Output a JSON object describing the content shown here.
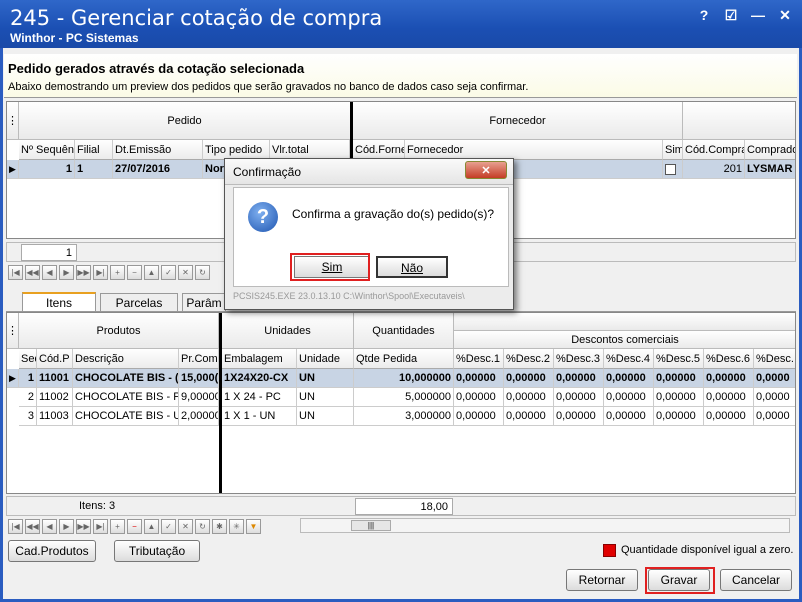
{
  "window": {
    "title": "245 - Gerenciar cotação de compra",
    "subtitle": "Winthor - PC Sistemas",
    "controls": [
      "?",
      "☑",
      "—",
      "✕"
    ]
  },
  "header": {
    "title": "Pedido gerados através da cotação selecionada",
    "description": "Abaixo demostrando um preview dos pedidos que serão gravados no banco de dados caso seja confirmar."
  },
  "orders": {
    "group_headers": {
      "pedido": "Pedido",
      "fornecedor": "Fornecedor"
    },
    "columns": [
      "Nº Sequên",
      "Filial",
      "Dt.Emissão",
      "Tipo pedido",
      "Vlr.total",
      "Cód.Forne",
      "Fornecedor",
      "Sim",
      "Cód.Compra",
      "Comprado"
    ],
    "row": {
      "seq": "1",
      "filial": "1",
      "dt": "27/07/2016",
      "tipo": "Nor",
      "cod_compra": "201",
      "comprador": "LYSMAR"
    },
    "footer_count": "1"
  },
  "tabs": [
    "Itens",
    "Parcelas",
    "Parâm"
  ],
  "items": {
    "group_headers": {
      "produtos": "Produtos",
      "unidades": "Unidades",
      "quantidades": "Quantidades",
      "descontos": "Descontos comerciais"
    },
    "columns": [
      "Seq",
      "Cód.P",
      "Descrição",
      "Pr.Com",
      "Embalagem",
      "Unidade",
      "Qtde Pedida",
      "%Desc.1",
      "%Desc.2",
      "%Desc.3",
      "%Desc.4",
      "%Desc.5",
      "%Desc.6",
      "%Desc."
    ],
    "rows": [
      {
        "seq": "1",
        "cod": "11001",
        "desc": "CHOCOLATE BIS - (",
        "pr": "15,000(",
        "emb": "1X24X20-CX",
        "un": "UN",
        "qtd": "10,000000",
        "d": [
          "0,00000",
          "0,00000",
          "0,00000",
          "0,00000",
          "0,00000",
          "0,00000",
          "0,0000"
        ]
      },
      {
        "seq": "2",
        "cod": "11002",
        "desc": "CHOCOLATE BIS - P/",
        "pr": "9,00000(",
        "emb": "1 X 24 - PC",
        "un": "UN",
        "qtd": "5,000000",
        "d": [
          "0,00000",
          "0,00000",
          "0,00000",
          "0,00000",
          "0,00000",
          "0,00000",
          "0,0000"
        ]
      },
      {
        "seq": "3",
        "cod": "11003",
        "desc": "CHOCOLATE BIS - UI",
        "pr": "2,00000(",
        "emb": "1 X 1 - UN",
        "un": "UN",
        "qtd": "3,000000",
        "d": [
          "0,00000",
          "0,00000",
          "0,00000",
          "0,00000",
          "0,00000",
          "0,00000",
          "0,0000"
        ]
      }
    ],
    "footer": {
      "count": "Itens: 3",
      "total": "18,00"
    }
  },
  "buttons": {
    "cad_produtos": "Cad.Produtos",
    "tributacao": "Tributação",
    "retornar": "Retornar",
    "gravar": "Gravar",
    "cancelar": "Cancelar"
  },
  "legend": {
    "text": "Quantidade disponível igual a zero.",
    "color": "#e00000"
  },
  "dialog": {
    "title": "Confirmação",
    "message": "Confirma a gravação do(s) pedido(s)?",
    "yes": "Sim",
    "no": "Não",
    "close": "✕",
    "status": "PCSIS245.EXE 23.0.13.10 C:\\Winthor\\Spool\\Executaveis\\"
  }
}
